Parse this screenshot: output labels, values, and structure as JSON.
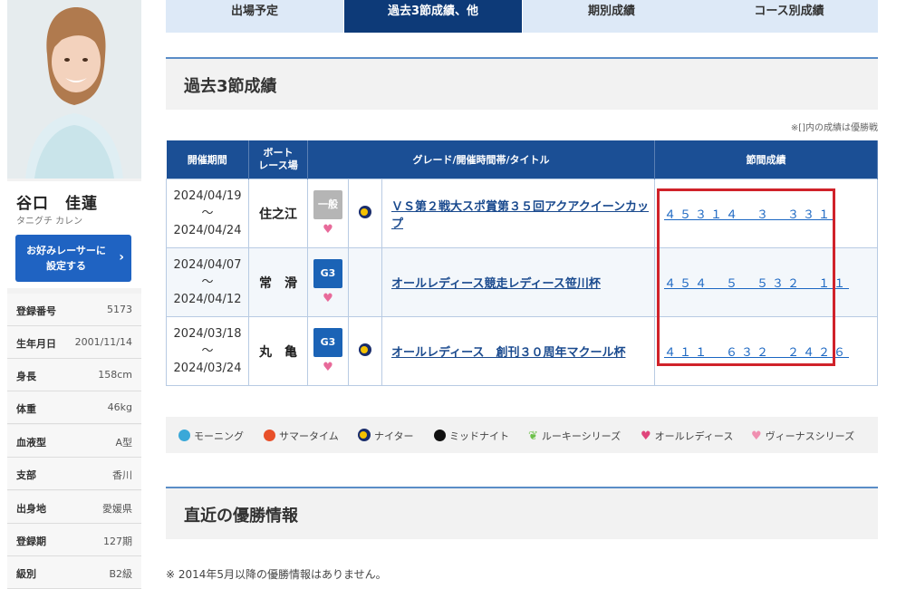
{
  "profile": {
    "name": "谷口　佳蓮",
    "kana": "タニグチ カレン",
    "fav_button": "お好みレーサーに\n設定する",
    "rows": [
      {
        "label": "登録番号",
        "value": "5173"
      },
      {
        "label": "生年月日",
        "value": "2001/11/14"
      },
      {
        "label": "身長",
        "value": "158cm"
      },
      {
        "label": "体重",
        "value": "46kg"
      },
      {
        "label": "血液型",
        "value": "A型"
      },
      {
        "label": "支部",
        "value": "香川"
      },
      {
        "label": "出身地",
        "value": "愛媛県"
      },
      {
        "label": "登録期",
        "value": "127期"
      },
      {
        "label": "級別",
        "value": "B2級"
      }
    ]
  },
  "tabs": [
    "出場予定",
    "過去3節成績、他",
    "期別成績",
    "コース別成績"
  ],
  "active_tab": 1,
  "section1": {
    "title": "過去3節成績",
    "note": "※[]内の成績は優勝戦",
    "headers": [
      "開催期間",
      "ボート\nレース場",
      "グレード/開催時間帯/タイトル",
      "節間成績"
    ],
    "rows": [
      {
        "period_start": "2024/04/19",
        "tilde": "～",
        "period_end": "2024/04/24",
        "venue": "住之江",
        "grade": "一般",
        "time_icon": "moon-icon",
        "title": "ＶＳ第２戦大スポ賞第３５回アクアクイーンカップ",
        "result": "４５３１４　３　３３１"
      },
      {
        "period_start": "2024/04/07",
        "tilde": "～",
        "period_end": "2024/04/12",
        "venue": "常　滑",
        "grade": "G3",
        "time_icon": "",
        "title": "オールレディース競走レディース笹川杯",
        "result": "４５４　５　５３２　１１"
      },
      {
        "period_start": "2024/03/18",
        "tilde": "～",
        "period_end": "2024/03/24",
        "venue": "丸　亀",
        "grade": "G3",
        "time_icon": "moon-icon",
        "title": "オールレディース　創刊３０周年マクール杯",
        "result": "４１１　６３２　２４２６"
      }
    ]
  },
  "legend": [
    {
      "label": "モーニング",
      "icon": "morning-icon",
      "color": "#3aa8d8"
    },
    {
      "label": "サマータイム",
      "icon": "summertime-icon",
      "color": "#e8502a"
    },
    {
      "label": "ナイター",
      "icon": "nighter-icon",
      "color": "#1a2d6b"
    },
    {
      "label": "ミッドナイト",
      "icon": "midnight-icon",
      "color": "#111111"
    },
    {
      "label": "ルーキーシリーズ",
      "icon": "rookie-icon",
      "color": "#6cc04a"
    },
    {
      "label": "オールレディース",
      "icon": "all-ladies-heart-icon",
      "color": "#e0457b"
    },
    {
      "label": "ヴィーナスシリーズ",
      "icon": "venus-heart-icon",
      "color": "#f08fb0"
    }
  ],
  "section2": {
    "title": "直近の優勝情報",
    "footnote": "※ 2014年5月以降の優勝情報はありません。"
  },
  "colors": {
    "accent": "#0d3a78",
    "header": "#1b4f95",
    "highlight": "#d0222a",
    "link": "#1a66c2"
  }
}
